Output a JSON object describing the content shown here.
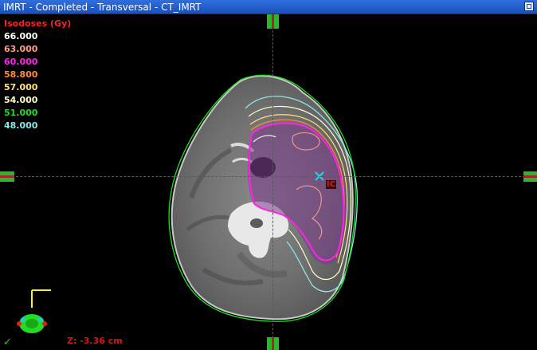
{
  "window": {
    "title": "IMRT  -  Completed - Transversal - CT_IMRT"
  },
  "legend": {
    "heading": "Isodoses (Gy)",
    "levels": [
      {
        "value": "66.000",
        "color": "#ffffff"
      },
      {
        "value": "63.000",
        "color": "#ff9a8a"
      },
      {
        "value": "60.000",
        "color": "#ff22e8"
      },
      {
        "value": "58.800",
        "color": "#ff8c3a"
      },
      {
        "value": "57.000",
        "color": "#ffe27a"
      },
      {
        "value": "54.000",
        "color": "#ffffc8"
      },
      {
        "value": "51.000",
        "color": "#22dd22"
      },
      {
        "value": "48.000",
        "color": "#8ce6e6"
      }
    ]
  },
  "viewport": {
    "z_position": "Z: -3.36 cm",
    "structure_label": "IC",
    "status_check": "✓"
  },
  "icons": {
    "orientation": "patient-orientation-icon",
    "isocenter": "isocenter-x-icon"
  }
}
